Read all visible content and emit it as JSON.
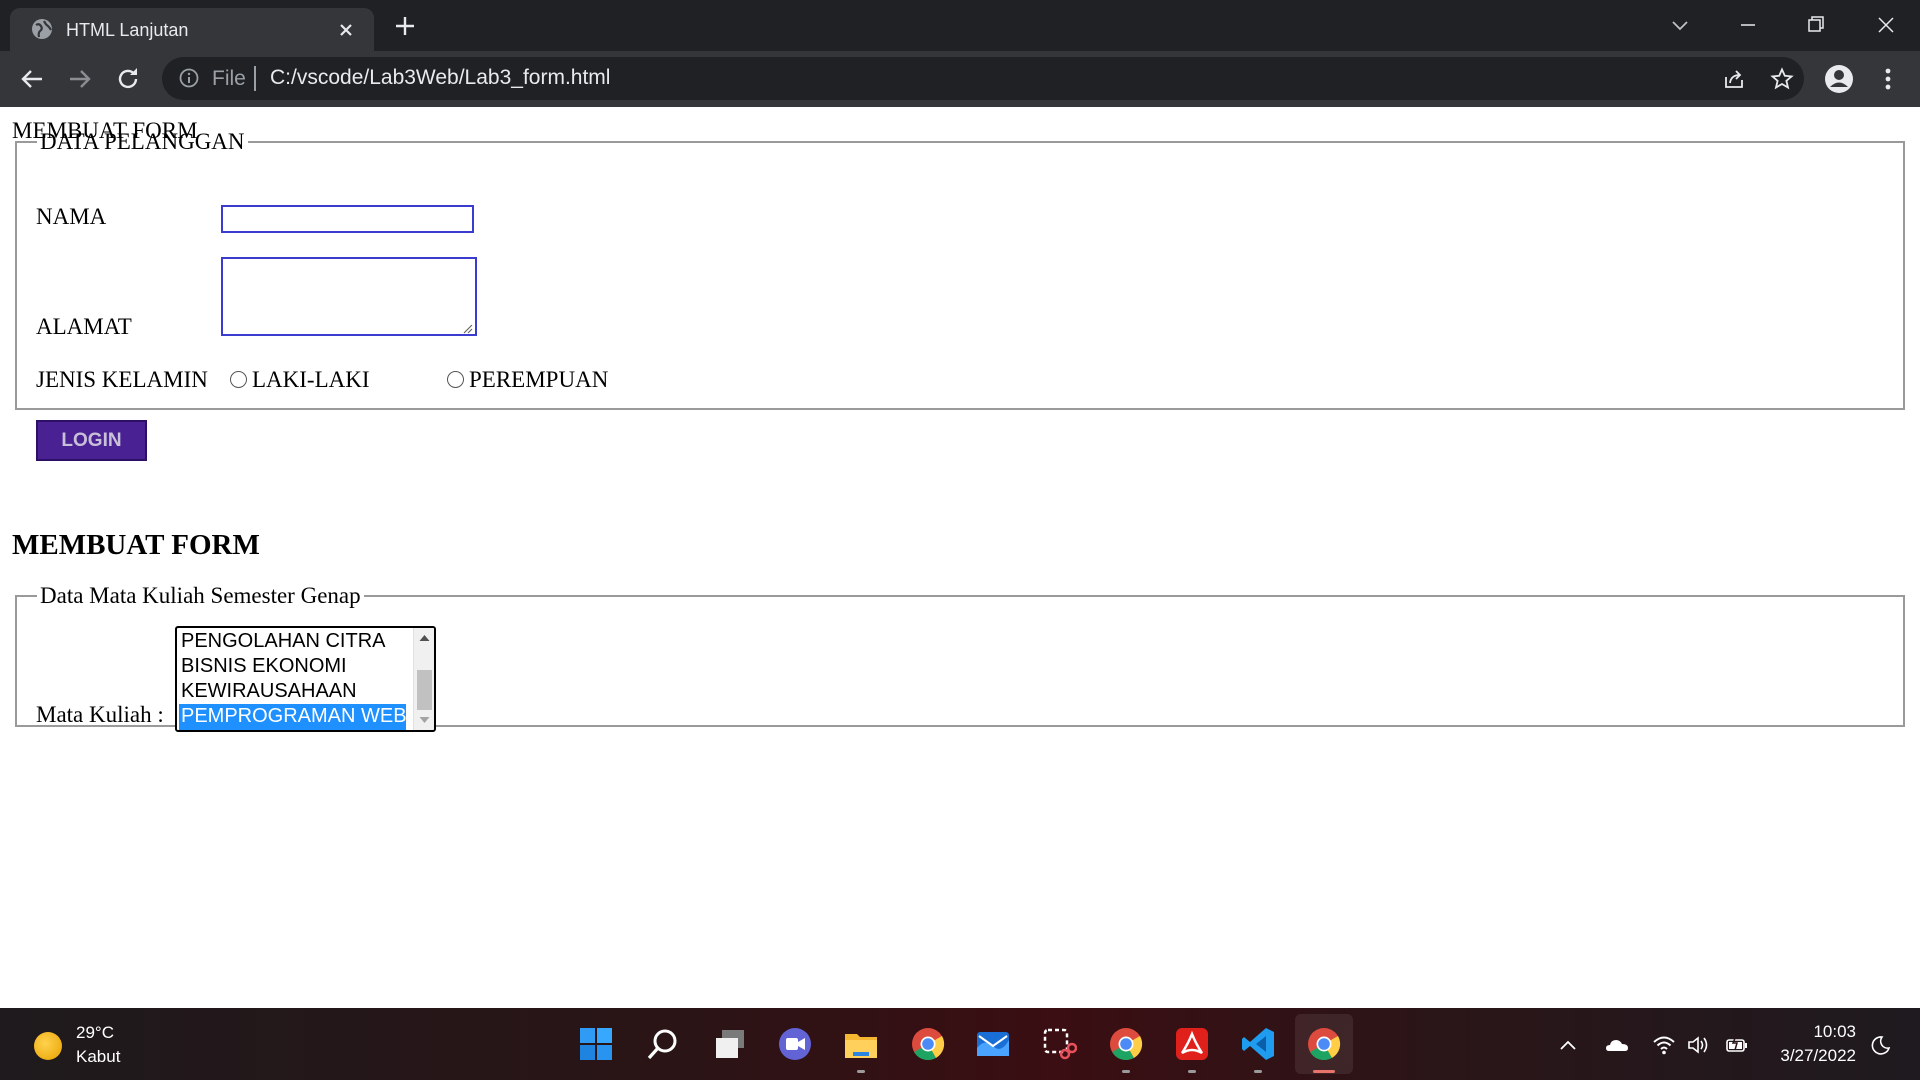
{
  "browser": {
    "tab_title": "HTML Lanjutan",
    "url_scheme": "File",
    "url": "C:/vscode/Lab3Web/Lab3_form.html",
    "icons": [
      "globe-icon",
      "close-icon",
      "plus-icon",
      "chevron-down-icon",
      "minimize-icon",
      "restore-icon",
      "back-icon",
      "forward-icon",
      "reload-icon",
      "info-icon",
      "share-icon",
      "star-icon",
      "profile-icon",
      "kebab-menu-icon"
    ]
  },
  "page": {
    "heading": "MEMBUAT FORM",
    "form1": {
      "legend": "DATA PELANGGAN",
      "nama_label": "NAMA",
      "nama_value": "",
      "alamat_label": "ALAMAT",
      "alamat_value": "",
      "gender_label": "JENIS KELAMIN",
      "gender_options": [
        "LAKI-LAKI",
        "PEREMPUAN"
      ],
      "login_label": "LOGIN",
      "login_color": "#4a2193"
    },
    "section_heading": "MEMBUAT FORM",
    "form2": {
      "legend": "Data Mata Kuliah Semester Genap",
      "matkul_label": "Mata Kuliah :",
      "options": [
        "PENGOLAHAN CITRA",
        "BISNIS EKONOMI",
        "KEWIRAUSAHAAN",
        "PEMPROGRAMAN WEB"
      ],
      "selected": "PEMPROGRAMAN WEB",
      "selected_color": "#1e90ff"
    }
  },
  "taskbar": {
    "weather_temp": "29°C",
    "weather_desc": "Kabut",
    "time": "10:03",
    "date": "3/27/2022",
    "apps": [
      "windows-start-icon",
      "search-icon",
      "task-view-icon",
      "teams-chat-icon",
      "file-explorer-icon",
      "chrome-icon",
      "mail-icon",
      "snipping-tool-icon",
      "chrome-icon",
      "acrobat-icon",
      "vscode-icon",
      "chrome-icon"
    ],
    "tray": [
      "chevron-up-icon",
      "onedrive-icon",
      "wifi-icon",
      "volume-icon",
      "battery-icon",
      "focus-moon-icon"
    ]
  }
}
